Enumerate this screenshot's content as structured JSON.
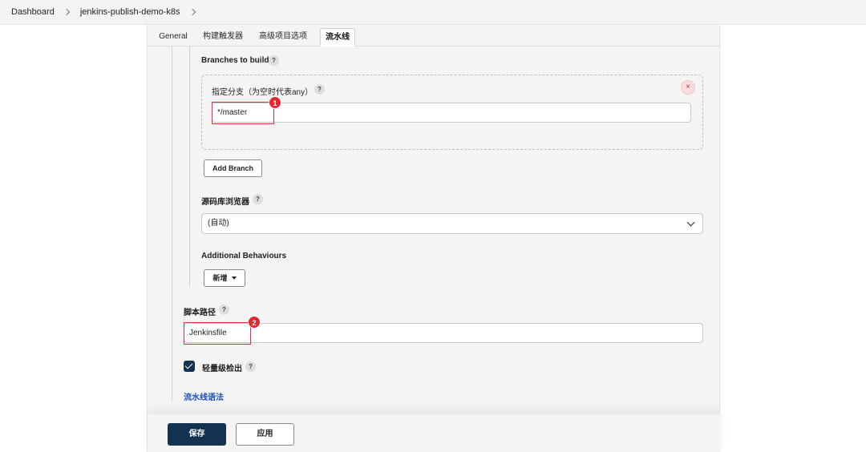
{
  "breadcrumb": {
    "items": [
      "Dashboard",
      "jenkins-publish-demo-k8s"
    ]
  },
  "tabs": [
    "General",
    "构建触发器",
    "高级项目选项",
    "流水线"
  ],
  "active_tab": "流水线",
  "branches": {
    "label": "Branches to build",
    "help": "?",
    "specifier_label": "指定分支（为空时代表any）",
    "specifier_help": "?",
    "specifier_value": "*/master",
    "close": "×",
    "add_branch": "Add Branch"
  },
  "browser": {
    "label": "源码库浏览器",
    "help": "?",
    "value": "(自动)"
  },
  "behaviours": {
    "label": "Additional Behaviours",
    "add_label": "新增"
  },
  "script_path": {
    "label": "脚本路径",
    "help": "?",
    "value": "Jenkinsfile"
  },
  "lightweight": {
    "label": "轻量级检出",
    "help": "?",
    "checked": true
  },
  "pipeline_syntax": "流水线语法",
  "annotations": {
    "badge1": "1",
    "badge2": "2",
    "color": "#e4262f"
  },
  "footer": {
    "save": "保存",
    "apply": "应用"
  },
  "colors": {
    "primary": "#13324f",
    "link": "#1e4fb5",
    "highlight": "#e0303a"
  }
}
